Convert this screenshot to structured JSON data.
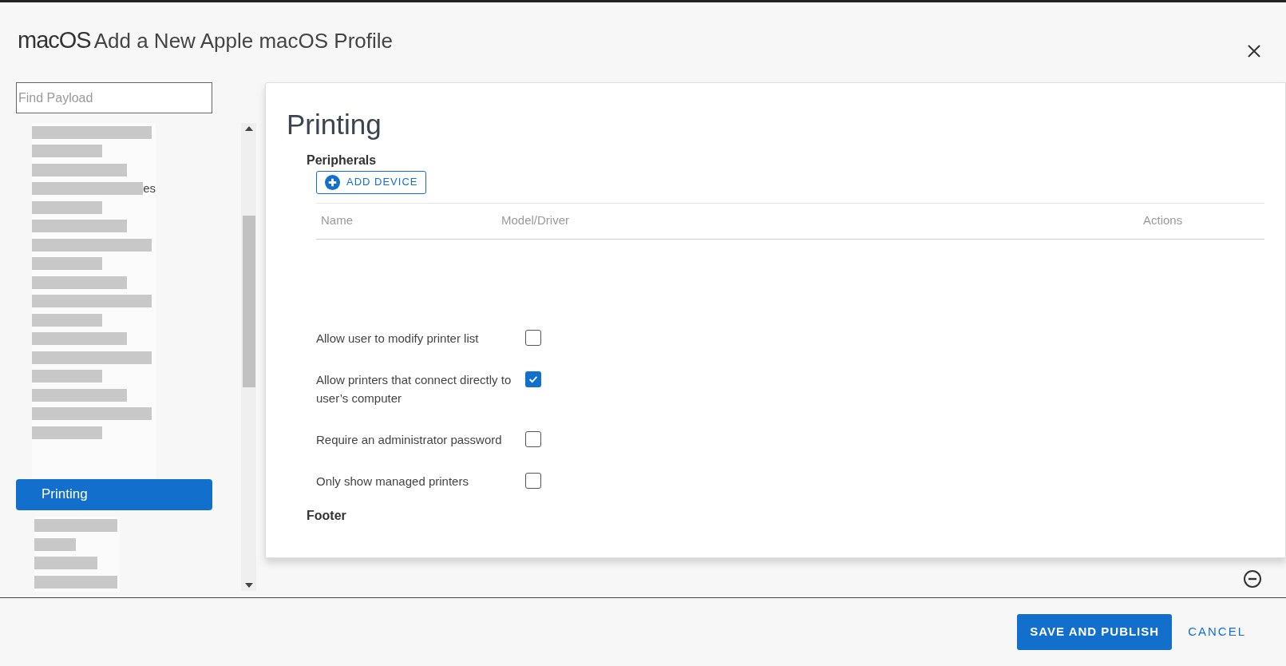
{
  "header": {
    "logo": "macOS",
    "title": "Add a New Apple macOS Profile"
  },
  "sidebar": {
    "search": {
      "placeholder": "Find Payload"
    },
    "items_above": [
      {
        "kind": "redacted"
      },
      {
        "kind": "redacted"
      },
      {
        "kind": "redacted"
      },
      {
        "kind": "redacted",
        "fragment": "es"
      },
      {
        "kind": "redacted"
      },
      {
        "kind": "redacted"
      },
      {
        "kind": "redacted"
      },
      {
        "kind": "redacted"
      },
      {
        "kind": "redacted"
      },
      {
        "kind": "redacted"
      },
      {
        "kind": "redacted"
      },
      {
        "kind": "redacted"
      },
      {
        "kind": "redacted"
      },
      {
        "kind": "redacted"
      },
      {
        "kind": "redacted"
      },
      {
        "kind": "redacted"
      },
      {
        "kind": "redacted"
      }
    ],
    "selected_item": {
      "label": "Printing",
      "selected": true
    },
    "items_below": [
      {
        "kind": "redacted"
      },
      {
        "kind": "redacted"
      },
      {
        "kind": "redacted"
      },
      {
        "kind": "redacted"
      }
    ]
  },
  "panel": {
    "title": "Printing",
    "section": "Peripherals",
    "add_button": "ADD DEVICE",
    "table": {
      "columns": [
        "Name",
        "Model/Driver",
        "Actions"
      ]
    },
    "options": [
      {
        "label": "Allow user to modify printer list",
        "checked": false
      },
      {
        "label": "Allow printers that connect directly to user’s computer",
        "checked": true
      },
      {
        "label": "Require an administrator password",
        "checked": false
      },
      {
        "label": "Only show managed printers",
        "checked": false
      }
    ],
    "next_section": "Footer"
  },
  "footer": {
    "primary": "SAVE AND PUBLISH",
    "cancel": "CANCEL"
  }
}
